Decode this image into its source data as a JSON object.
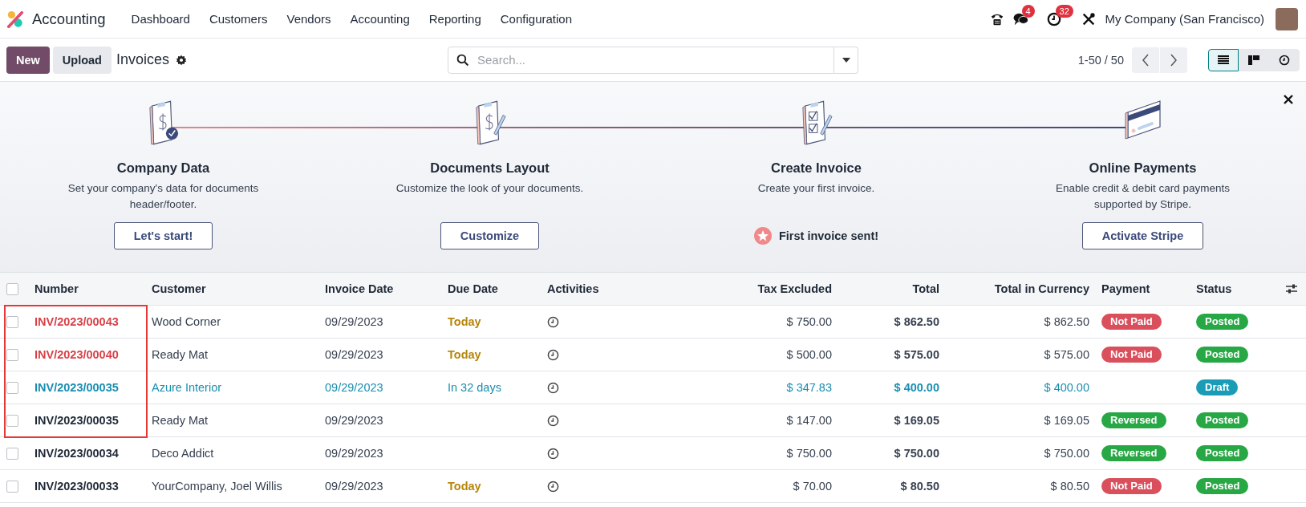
{
  "navbar": {
    "app_name": "Accounting",
    "menu": [
      "Dashboard",
      "Customers",
      "Vendors",
      "Accounting",
      "Reporting",
      "Configuration"
    ],
    "messages_count": "4",
    "activities_count": "32",
    "company": "My Company (San Francisco)"
  },
  "control_panel": {
    "new_button": "New",
    "upload_button": "Upload",
    "title": "Invoices",
    "search": {
      "placeholder": "Search..."
    },
    "pager": "1-50 / 50",
    "views": [
      {
        "selected": true
      },
      {
        "selected": false
      },
      {
        "selected": false
      }
    ]
  },
  "onboarding": {
    "steps": [
      {
        "title": "Company Data",
        "description": "Set your company's data for documents header/footer.",
        "done": true,
        "action": {
          "kind": "button",
          "label": "Let's start!"
        }
      },
      {
        "title": "Documents Layout",
        "description": "Customize the look of your documents.",
        "done": false,
        "action": {
          "kind": "button",
          "label": "Customize"
        }
      },
      {
        "title": "Create Invoice",
        "description": "Create your first invoice.",
        "done": false,
        "action": {
          "kind": "achievement",
          "label": "First invoice sent!"
        }
      },
      {
        "title": "Online Payments",
        "description": "Enable credit & debit card payments supported by Stripe.",
        "done": false,
        "action": {
          "kind": "button",
          "label": "Activate Stripe"
        }
      }
    ]
  },
  "table": {
    "select_all": {
      "checked": false
    },
    "columns": [
      "Number",
      "Customer",
      "Invoice Date",
      "Due Date",
      "Activities",
      "Tax Excluded",
      "Total",
      "Total in Currency",
      "Payment",
      "Status"
    ],
    "rows": [
      {
        "checked": false,
        "highlighted": true,
        "kind": "overdue",
        "number": "INV/2023/00043",
        "customer": "Wood Corner",
        "invoice_date": "09/29/2023",
        "due_date": {
          "text": "Today",
          "kind": "today"
        },
        "tax_excluded": "$ 750.00",
        "total": "$ 862.50",
        "total_in_currency": "$ 862.50",
        "payment": {
          "label": "Not Paid",
          "color": "#d94f5c"
        },
        "status": {
          "label": "Posted",
          "color": "#28a745"
        }
      },
      {
        "checked": false,
        "highlighted": true,
        "kind": "overdue",
        "number": "INV/2023/00040",
        "customer": "Ready Mat",
        "invoice_date": "09/29/2023",
        "due_date": {
          "text": "Today",
          "kind": "today"
        },
        "tax_excluded": "$ 500.00",
        "total": "$ 575.00",
        "total_in_currency": "$ 575.00",
        "payment": {
          "label": "Not Paid",
          "color": "#d94f5c"
        },
        "status": {
          "label": "Posted",
          "color": "#28a745"
        }
      },
      {
        "checked": false,
        "highlighted": true,
        "kind": "draft",
        "number": "INV/2023/00035",
        "customer": "Azure Interior",
        "invoice_date": "09/29/2023",
        "due_date": {
          "text": "In 32 days",
          "kind": "future"
        },
        "tax_excluded": "$ 347.83",
        "total": "$ 400.00",
        "total_in_currency": "$ 400.00",
        "status": {
          "label": "Draft",
          "color": "#1a9cb7"
        }
      },
      {
        "checked": false,
        "highlighted": true,
        "kind": "normal",
        "number": "INV/2023/00035",
        "customer": "Ready Mat",
        "invoice_date": "09/29/2023",
        "tax_excluded": "$ 147.00",
        "total": "$ 169.05",
        "total_in_currency": "$ 169.05",
        "payment": {
          "label": "Reversed",
          "color": "#28a745"
        },
        "status": {
          "label": "Posted",
          "color": "#28a745"
        }
      },
      {
        "checked": false,
        "highlighted": false,
        "kind": "normal",
        "number": "INV/2023/00034",
        "customer": "Deco Addict",
        "invoice_date": "09/29/2023",
        "tax_excluded": "$ 750.00",
        "total": "$ 750.00",
        "total_in_currency": "$ 750.00",
        "payment": {
          "label": "Reversed",
          "color": "#28a745"
        },
        "status": {
          "label": "Posted",
          "color": "#28a745"
        }
      },
      {
        "checked": false,
        "highlighted": false,
        "kind": "normal",
        "number": "INV/2023/00033",
        "customer": "YourCompany, Joel Willis",
        "invoice_date": "09/29/2023",
        "due_date": {
          "text": "Today",
          "kind": "today"
        },
        "tax_excluded": "$ 70.00",
        "total": "$ 80.50",
        "total_in_currency": "$ 80.50",
        "payment": {
          "label": "Not Paid",
          "color": "#d94f5c"
        },
        "status": {
          "label": "Posted",
          "color": "#28a745"
        }
      }
    ]
  }
}
